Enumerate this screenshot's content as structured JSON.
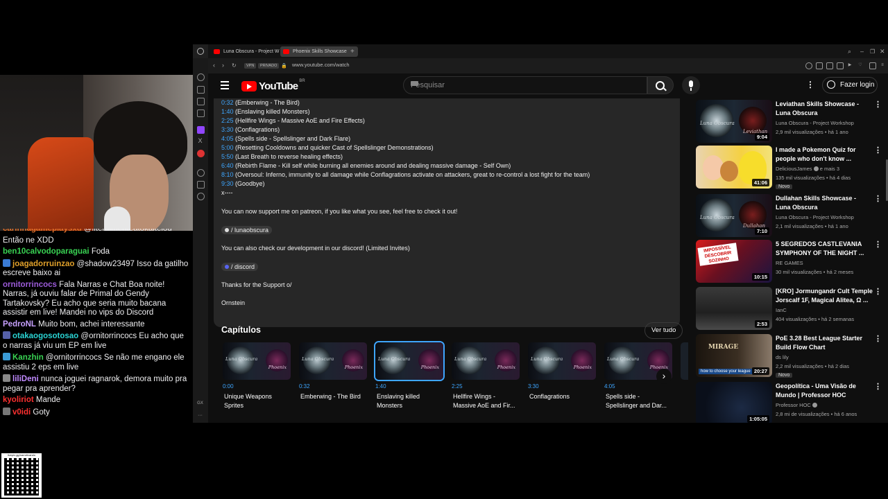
{
  "browser": {
    "tabs": [
      {
        "label": "Luna Obscura - Project W"
      },
      {
        "label": "Phoenix Skills Showcase"
      }
    ],
    "new_tab_label": "+",
    "url": "www.youtube.com/watch",
    "vpn_label": "VPN",
    "private_label": "PRIVADO"
  },
  "youtube": {
    "logo_text": "YouTube",
    "country_code": "BR",
    "search_placeholder": "Pesquisar",
    "login_label": "Fazer login"
  },
  "description": {
    "timestamps": [
      {
        "time": "0:32",
        "text": " (Emberwing - The Bird)"
      },
      {
        "time": "1:40",
        "text": " (Enslaving killed Monsters)"
      },
      {
        "time": "2:25",
        "text": " (Hellfire Wings - Massive AoE and Fire Effects)"
      },
      {
        "time": "3:30",
        "text": " (Conflagrations)"
      },
      {
        "time": "4:05",
        "text": " (Spells side - Spellslinger and Dark Flare)"
      },
      {
        "time": "5:00",
        "text": " (Resetting Cooldowns and quicker Cast of Spellslinger Demonstrations)"
      },
      {
        "time": "5:50",
        "text": " (Last Breath to reverse healing effects)"
      },
      {
        "time": "6:40",
        "text": " (Rebirth Flame - Kill self while burning all enemies around and dealing massive damage - Self Own)"
      },
      {
        "time": "8:10",
        "text": " (Oversoul: Inferno, immunity to all damage while Conflagrations activate on attackers, great to re-control a lost fight for the team)"
      },
      {
        "time": "9:30",
        "text": " (Goodbye)"
      }
    ],
    "separator": "x----",
    "patreon_text": "You can now support me on patreon, if you like what you see, feel free to check it out!",
    "patreon_chip": "/ lunaobscura",
    "discord_text": "You can also check our development in our discord! (Limited Invites)",
    "discord_chip": "/ discord",
    "thanks": "Thanks for the Support o/",
    "signature": "Ornstein"
  },
  "chapters": {
    "title": "Capítulos",
    "see_all": "Ver tudo",
    "thumb_left_label": "Luna Obscura",
    "thumb_right_label": "Phoenix",
    "items": [
      {
        "time": "0:00",
        "title": "Unique Weapons Sprites"
      },
      {
        "time": "0:32",
        "title": "Emberwing - The Bird"
      },
      {
        "time": "1:40",
        "title": "Enslaving killed Monsters"
      },
      {
        "time": "2:25",
        "title": "Hellfire Wings - Massive AoE and Fir..."
      },
      {
        "time": "3:30",
        "title": "Conflagrations"
      },
      {
        "time": "4:05",
        "title": "Spells side - Spellslinger and Dar..."
      }
    ],
    "active_index": 2
  },
  "recommendations": [
    {
      "title": "Leviathan Skills Showcase - Luna Obscura",
      "channel": "Luna Obscura - Project Workshop",
      "meta": "2,9 mil visualizações • há 1 ano",
      "duration": "9:04",
      "thumb_label_left": "Luna Obscura",
      "thumb_label_right": "Leviathan"
    },
    {
      "title": "I made a Pokemon Quiz for people who don't know ...",
      "channel": "DeliciousJames",
      "channel_extra": "e mais 3",
      "meta": "135 mil visualizações • há 4 dias",
      "duration": "41:06",
      "badge": "Novo"
    },
    {
      "title": "Dullahan Skills Showcase - Luna Obscura",
      "channel": "Luna Obscura - Project Workshop",
      "meta": "2,1 mil visualizações • há 1 ano",
      "duration": "7:10",
      "thumb_label_left": "Luna Obscura",
      "thumb_label_right": "Dullahan"
    },
    {
      "title": "5 SEGREDOS CASTLEVANIA SYMPHONY OF THE NIGHT ...",
      "channel": "RE GAMES",
      "meta": "30 mil visualizações • há 2 meses",
      "duration": "10:15",
      "thumb_text": "IMPOSSÍVEL DESCOBRIR SOZINHO"
    },
    {
      "title": "[KRO] Jormungandr Cult Temple Jorscalf 1F, Magical Alitea, Ω ...",
      "channel": "IanC",
      "meta": "404 visualizações • há 2 semanas",
      "duration": "2:53"
    },
    {
      "title": "PoE 3.28 Best League Starter Build Flow Chart",
      "channel": "ds lily",
      "meta": "2,2 mil visualizações • há 2 dias",
      "duration": "20:27",
      "badge": "Novo",
      "thumb_text": "MIRAGE",
      "thumb_caption": "how to choose your league"
    },
    {
      "title": "Geopolítica - Uma Visão de Mundo | Professor HOC",
      "channel": "Professor HOC",
      "meta": "2,8 mi de visualizações • há 6 anos",
      "duration": "1:05:05"
    }
  ],
  "chat": {
    "messages": [
      {
        "user": "carinhagameplaysxd",
        "text": " @literalmenteatokaiteiou",
        "color": "#e0702a"
      },
      {
        "user": "",
        "text": "Então ne XDD",
        "color": "#efeff1"
      },
      {
        "user": "ben10calvodoparaguai",
        "text": " Foda",
        "color": "#39d353"
      },
      {
        "user": "joagadorruinzao",
        "text": " @shadow23497 Isso da gatilho escreve baixo ai",
        "color": "#e0a02a",
        "badge": "#3a7bd5"
      },
      {
        "user": "ornitorrincocs",
        "text": " Fala Narras e Chat Boa noite! Narras, já ouviu falar de Primal do Gendy Tartakovsky? Eu acho que seria muito bacana assistir em live! Mandei no vips do Discord",
        "color": "#9c5bd9"
      },
      {
        "user": "PedroNL",
        "text": " Muito bom, achei interessante",
        "color": "#c7a0ff"
      },
      {
        "user": "otakaogosotosao",
        "text": " @ornitorrincocs Eu acho que o narras já viu um EP em live",
        "color": "#2ad3d3",
        "badge": "#5560a8"
      },
      {
        "user": "Kanzhin",
        "text": " @ornitorrincocs Se não me engano ele assistiu 2 eps em live",
        "color": "#39d353",
        "badge": "#3a9ad5"
      },
      {
        "user": "liliDeni",
        "text": " nunca joguei ragnarok, demora muito pra pegar pra aprender?",
        "color": "#c08aff",
        "badge": "#888888"
      },
      {
        "user": "kyoliriot",
        "text": " Mande",
        "color": "#ff3030"
      },
      {
        "user": "v0idi",
        "text": " Goty",
        "color": "#ff3030",
        "badge": "#777777"
      }
    ]
  },
  "qr": {
    "url": "livepix.gg/narrotivando"
  },
  "colors": {
    "link": "#3ea6ff",
    "yt_red": "#ff0000",
    "bg": "#0f0f0f"
  }
}
